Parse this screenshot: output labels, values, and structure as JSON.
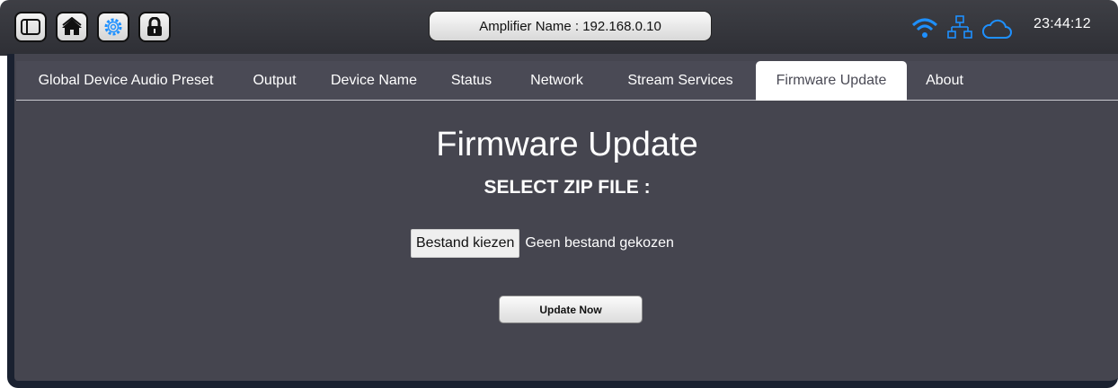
{
  "header": {
    "amplifier_name": "Amplifier Name : 192.168.0.10",
    "clock": "23:44:12",
    "left_buttons": [
      {
        "icon": "sidebar-toggle-icon"
      },
      {
        "icon": "home-icon"
      },
      {
        "icon": "gear-icon"
      },
      {
        "icon": "lock-icon"
      }
    ],
    "status_icons": [
      "wifi-icon",
      "network-icon",
      "cloud-icon"
    ],
    "colors": {
      "status_blue": "#1e90ff",
      "bar": "#35363c"
    }
  },
  "tabs": [
    {
      "label": "Global Device Audio Preset",
      "active": false
    },
    {
      "label": "Output",
      "active": false
    },
    {
      "label": "Device Name",
      "active": false
    },
    {
      "label": "Status",
      "active": false
    },
    {
      "label": "Network",
      "active": false
    },
    {
      "label": "Stream Services",
      "active": false
    },
    {
      "label": "Firmware Update",
      "active": true
    },
    {
      "label": "About",
      "active": false
    }
  ],
  "main": {
    "title": "Firmware Update",
    "subtitle": "SELECT ZIP FILE :",
    "file_button_label": "Bestand kiezen",
    "file_status": "Geen bestand gekozen",
    "update_button_label": "Update Now"
  }
}
